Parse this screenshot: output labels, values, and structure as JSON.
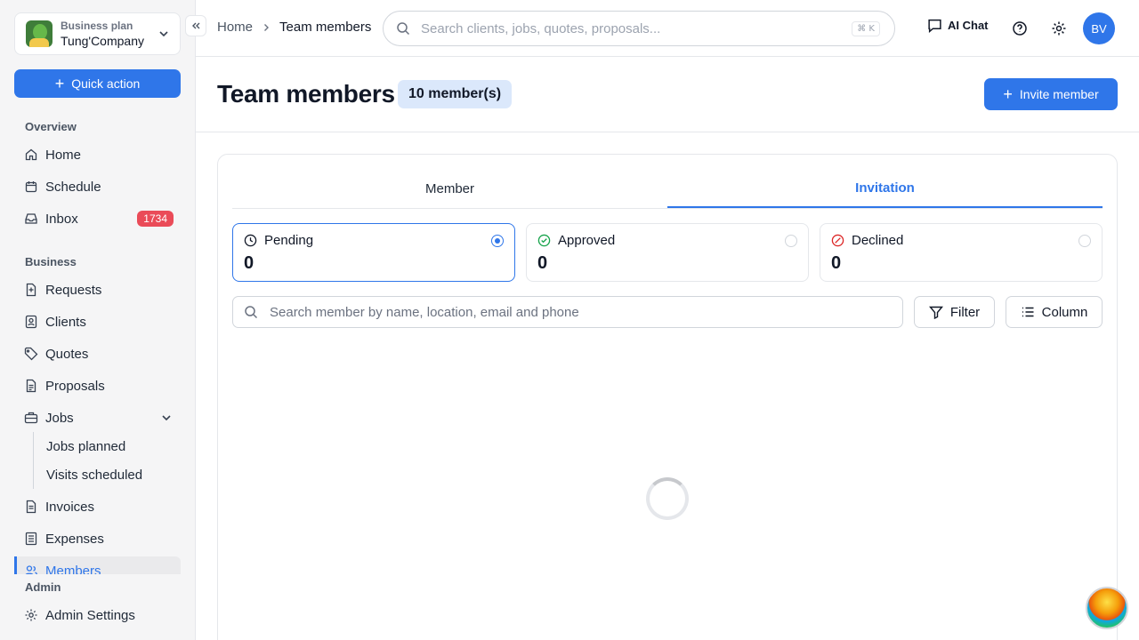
{
  "sidebar": {
    "company": {
      "plan": "Business plan",
      "name": "Tung'Company"
    },
    "quick_action": "Quick action",
    "sections": {
      "overview": "Overview",
      "business": "Business",
      "admin": "Admin"
    },
    "items": {
      "home": "Home",
      "schedule": "Schedule",
      "inbox": "Inbox",
      "inbox_count": "1734",
      "requests": "Requests",
      "clients": "Clients",
      "quotes": "Quotes",
      "proposals": "Proposals",
      "jobs": "Jobs",
      "jobs_planned": "Jobs planned",
      "visits_scheduled": "Visits scheduled",
      "invoices": "Invoices",
      "expenses": "Expenses",
      "members": "Members",
      "admin_settings": "Admin Settings"
    }
  },
  "topbar": {
    "breadcrumb": {
      "home": "Home",
      "current": "Team members"
    },
    "search_placeholder": "Search clients, jobs, quotes, proposals...",
    "shortcut": "⌘ K",
    "ai_chat": "AI Chat",
    "avatar_initials": "BV"
  },
  "header": {
    "title": "Team members",
    "member_count": "10 member(s)",
    "invite_label": "Invite member"
  },
  "tabs": {
    "member": "Member",
    "invitation": "Invitation",
    "active": "Invitation"
  },
  "statuses": [
    {
      "label": "Pending",
      "count": "0",
      "selected": true,
      "color": "#111827"
    },
    {
      "label": "Approved",
      "count": "0",
      "selected": false,
      "color": "#16a34a"
    },
    {
      "label": "Declined",
      "count": "0",
      "selected": false,
      "color": "#dc2626"
    }
  ],
  "member_search_placeholder": "Search member by name, location, email and phone",
  "toolbar": {
    "filter": "Filter",
    "column": "Column"
  },
  "colors": {
    "accent": "#2f76e9",
    "badge_red": "#ea4b58",
    "badge_blue_bg": "#dbe8fb"
  }
}
